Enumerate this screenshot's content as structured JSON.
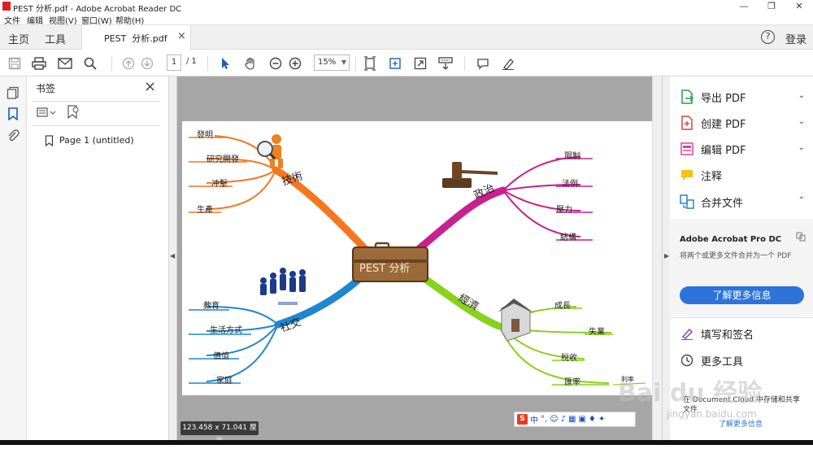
{
  "window": {
    "title": "PEST  分析.pdf - Adobe Acrobat Reader DC",
    "min": "—",
    "max": "❐",
    "close": "✕"
  },
  "menubar": {
    "items": [
      "文件",
      "编辑",
      "视图(V)",
      "窗口(W)",
      "帮助(H)"
    ]
  },
  "tabs": {
    "home": "主页",
    "tools": "工具",
    "file_tab": "PEST  分析.pdf",
    "close": "×",
    "help": "?",
    "login": "登录"
  },
  "toolbar": {
    "page_current": "1",
    "page_total": "/ 1",
    "zoom": "15%"
  },
  "bookmarks": {
    "title": "书签",
    "close": "×",
    "items": [
      {
        "label": "Page 1 (untitled)"
      }
    ]
  },
  "mindmap": {
    "center": "PEST 分析",
    "branches": {
      "tech": {
        "label": "技術",
        "color": "#f4771f",
        "items": [
          "發明",
          "研究開發",
          "冲擊",
          "生產"
        ]
      },
      "politics": {
        "label": "政治",
        "color": "#c8208e",
        "items": [
          "限制",
          "法例",
          "壓力",
          "結構"
        ]
      },
      "social": {
        "label": "社交",
        "color": "#1f86d0",
        "items": [
          "教育",
          "生活方式",
          "價值",
          "家庭"
        ]
      },
      "economy": {
        "label": "經濟",
        "color": "#87d21d",
        "items": [
          "成長",
          "失業",
          "稅收",
          "匯率"
        ],
        "extra": "利率"
      }
    }
  },
  "rightpane": {
    "items": [
      {
        "label": "导出 PDF",
        "icon": "export-pdf-icon",
        "color": "#2a9d4a",
        "chev": "⌄"
      },
      {
        "label": "创建 PDF",
        "icon": "create-pdf-icon",
        "color": "#e0443a",
        "chev": "⌄"
      },
      {
        "label": "编辑 PDF",
        "icon": "edit-pdf-icon",
        "color": "#e0449a",
        "chev": "⌄"
      },
      {
        "label": "注释",
        "icon": "comment-icon",
        "color": "#f2c21a",
        "chev": ""
      },
      {
        "label": "合并文件",
        "icon": "combine-files-icon",
        "color": "#2a7fd8",
        "chev": "⌃"
      }
    ],
    "promo_title": "Adobe Acrobat Pro DC",
    "promo_text": "将两个或更多文件合并为一个 PDF",
    "learn_more": "了解更多信息",
    "fill_sign": "填写和签名",
    "more_tools": "更多工具",
    "cloud_text": "在 Document Cloud 中存储和共享文件",
    "cloud_link": "了解更多信息"
  },
  "status": {
    "size": "123.458 x 71.041 厘米"
  },
  "ime": {
    "lang": "中",
    "punct": "°,"
  },
  "watermark": {
    "main": "Bai du 经验",
    "sub": "jingyan.baidu.com"
  }
}
